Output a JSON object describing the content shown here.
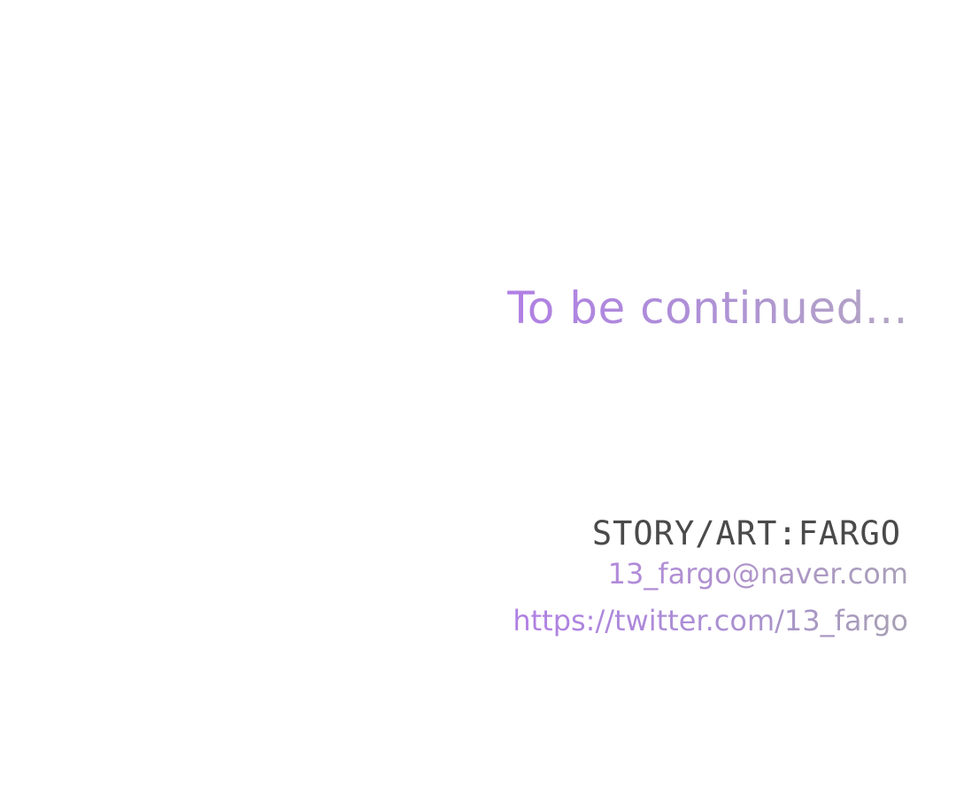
{
  "main": {
    "continued_text": "To be continued...",
    "credits": {
      "story_art": "STORY/ART:FARGO",
      "email": "13_fargo@naver.com",
      "twitter": "https://twitter.com/13_fargo"
    }
  },
  "colors": {
    "background": "#ffffff",
    "continued_start": "#b07fe4",
    "continued_end": "#b3a6c2",
    "story_text": "#4a4a4a",
    "link_start": "#b07fe4",
    "link_end": "#a7a0b3"
  }
}
